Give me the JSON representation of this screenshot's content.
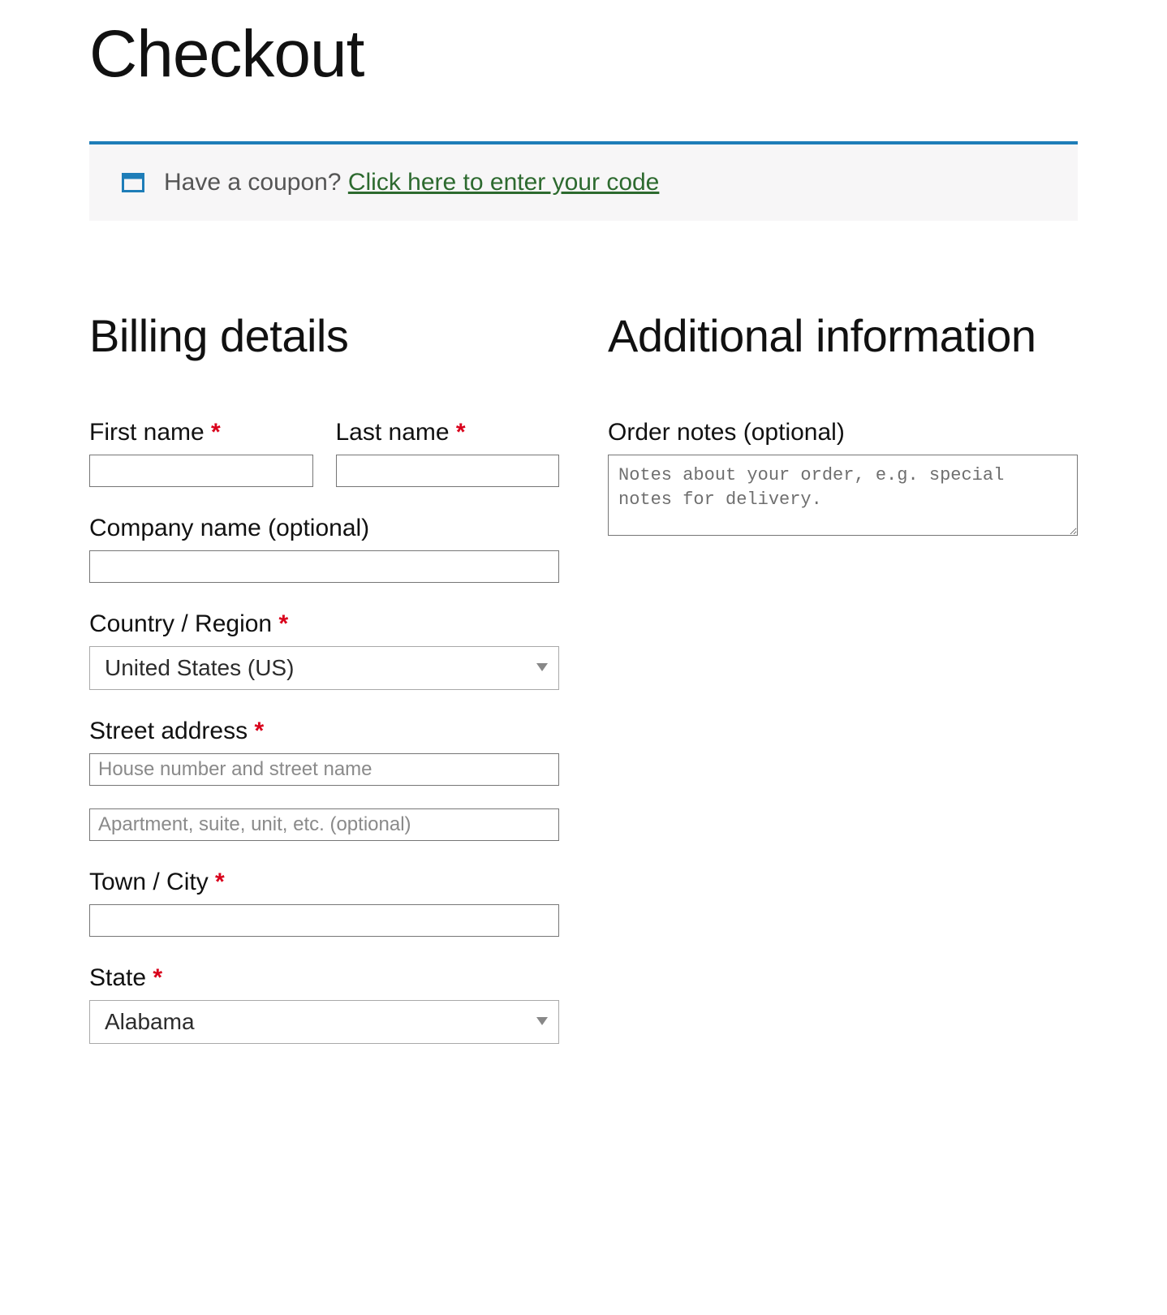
{
  "page": {
    "title": "Checkout"
  },
  "coupon_banner": {
    "prompt": "Have a coupon? ",
    "link_text": "Click here to enter your code",
    "icon": "calendar-icon"
  },
  "billing": {
    "heading": "Billing details",
    "first_name": {
      "label": "First name ",
      "required": "*",
      "value": ""
    },
    "last_name": {
      "label": "Last name ",
      "required": "*",
      "value": ""
    },
    "company": {
      "label": "Company name (optional)",
      "value": ""
    },
    "country": {
      "label": "Country / Region ",
      "required": "*",
      "selected": "United States (US)"
    },
    "street": {
      "label": "Street address ",
      "required": "*",
      "line1_placeholder": "House number and street name",
      "line1_value": "",
      "line2_placeholder": "Apartment, suite, unit, etc. (optional)",
      "line2_value": ""
    },
    "city": {
      "label": "Town / City ",
      "required": "*",
      "value": ""
    },
    "state": {
      "label": "State ",
      "required": "*",
      "selected": "Alabama"
    }
  },
  "additional": {
    "heading": "Additional information",
    "order_notes": {
      "label": "Order notes (optional)",
      "placeholder": "Notes about your order, e.g. special notes for delivery.",
      "value": ""
    }
  }
}
